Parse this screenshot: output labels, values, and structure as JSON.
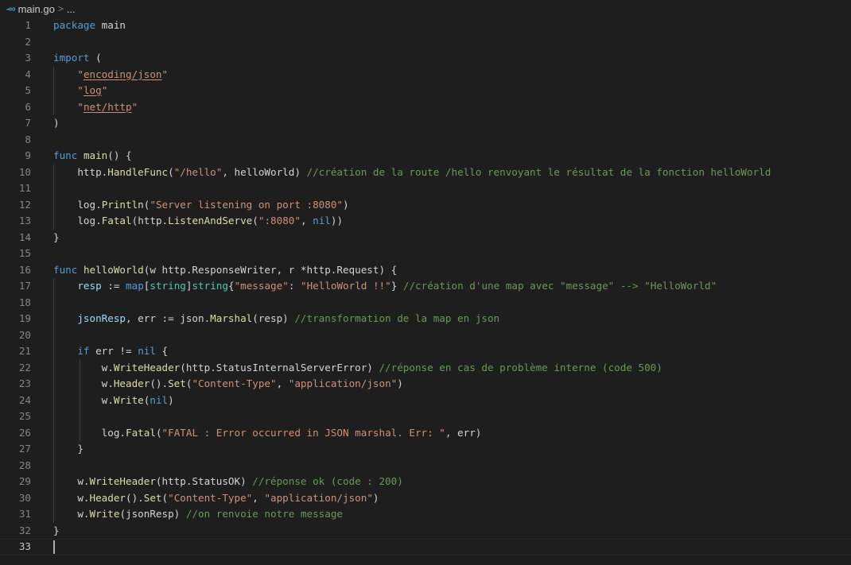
{
  "breadcrumb": {
    "icon": "go-file-icon",
    "icon_glyph": "-∞",
    "file": "main.go",
    "separator": ">",
    "more": "..."
  },
  "editor": {
    "current_line": 33,
    "lines": [
      {
        "n": "1",
        "indent": 0,
        "tokens": [
          {
            "t": "kw",
            "v": "package"
          },
          {
            "t": "pl",
            "v": " main"
          }
        ]
      },
      {
        "n": "2",
        "indent": 0,
        "tokens": []
      },
      {
        "n": "3",
        "indent": 0,
        "tokens": [
          {
            "t": "kw",
            "v": "import"
          },
          {
            "t": "pl",
            "v": " ("
          }
        ]
      },
      {
        "n": "4",
        "indent": 1,
        "tokens": [
          {
            "t": "str",
            "v": "\""
          },
          {
            "t": "imp",
            "v": "encoding/json"
          },
          {
            "t": "str",
            "v": "\""
          }
        ]
      },
      {
        "n": "5",
        "indent": 1,
        "tokens": [
          {
            "t": "str",
            "v": "\""
          },
          {
            "t": "imp",
            "v": "log"
          },
          {
            "t": "str",
            "v": "\""
          }
        ]
      },
      {
        "n": "6",
        "indent": 1,
        "tokens": [
          {
            "t": "str",
            "v": "\""
          },
          {
            "t": "imp",
            "v": "net/http"
          },
          {
            "t": "str",
            "v": "\""
          }
        ]
      },
      {
        "n": "7",
        "indent": 0,
        "tokens": [
          {
            "t": "pl",
            "v": ")"
          }
        ]
      },
      {
        "n": "8",
        "indent": 0,
        "tokens": []
      },
      {
        "n": "9",
        "indent": 0,
        "tokens": [
          {
            "t": "kw",
            "v": "func"
          },
          {
            "t": "pl",
            "v": " "
          },
          {
            "t": "fn",
            "v": "main"
          },
          {
            "t": "pl",
            "v": "() {"
          }
        ]
      },
      {
        "n": "10",
        "indent": 1,
        "tokens": [
          {
            "t": "pl",
            "v": "http."
          },
          {
            "t": "fn",
            "v": "HandleFunc"
          },
          {
            "t": "pl",
            "v": "("
          },
          {
            "t": "str",
            "v": "\"/hello\""
          },
          {
            "t": "pl",
            "v": ", helloWorld) "
          },
          {
            "t": "cmt",
            "v": "//création de la route /hello renvoyant le résultat de la fonction helloWorld"
          }
        ]
      },
      {
        "n": "11",
        "indent": 1,
        "tokens": []
      },
      {
        "n": "12",
        "indent": 1,
        "tokens": [
          {
            "t": "pl",
            "v": "log."
          },
          {
            "t": "fn",
            "v": "Println"
          },
          {
            "t": "pl",
            "v": "("
          },
          {
            "t": "str",
            "v": "\"Server listening on port :8080\""
          },
          {
            "t": "pl",
            "v": ")"
          }
        ]
      },
      {
        "n": "13",
        "indent": 1,
        "tokens": [
          {
            "t": "pl",
            "v": "log."
          },
          {
            "t": "fn",
            "v": "Fatal"
          },
          {
            "t": "pl",
            "v": "(http."
          },
          {
            "t": "fn",
            "v": "ListenAndServe"
          },
          {
            "t": "pl",
            "v": "("
          },
          {
            "t": "str",
            "v": "\":8080\""
          },
          {
            "t": "pl",
            "v": ", "
          },
          {
            "t": "kw",
            "v": "nil"
          },
          {
            "t": "pl",
            "v": "))"
          }
        ]
      },
      {
        "n": "14",
        "indent": 0,
        "tokens": [
          {
            "t": "pl",
            "v": "}"
          }
        ]
      },
      {
        "n": "15",
        "indent": 0,
        "tokens": []
      },
      {
        "n": "16",
        "indent": 0,
        "tokens": [
          {
            "t": "kw",
            "v": "func"
          },
          {
            "t": "pl",
            "v": " "
          },
          {
            "t": "fn",
            "v": "helloWorld"
          },
          {
            "t": "pl",
            "v": "(w http.ResponseWriter, r *http.Request) {"
          }
        ]
      },
      {
        "n": "17",
        "indent": 1,
        "tokens": [
          {
            "t": "var",
            "v": "resp"
          },
          {
            "t": "pl",
            "v": " := "
          },
          {
            "t": "kw",
            "v": "map"
          },
          {
            "t": "pl",
            "v": "["
          },
          {
            "t": "typ",
            "v": "string"
          },
          {
            "t": "pl",
            "v": "]"
          },
          {
            "t": "typ",
            "v": "string"
          },
          {
            "t": "pl",
            "v": "{"
          },
          {
            "t": "str",
            "v": "\"message\""
          },
          {
            "t": "pl",
            "v": ": "
          },
          {
            "t": "str",
            "v": "\"HelloWorld !!\""
          },
          {
            "t": "pl",
            "v": "} "
          },
          {
            "t": "cmt",
            "v": "//création d'une map avec \"message\" --> \"HelloWorld\""
          }
        ]
      },
      {
        "n": "18",
        "indent": 1,
        "tokens": []
      },
      {
        "n": "19",
        "indent": 1,
        "tokens": [
          {
            "t": "var",
            "v": "jsonResp"
          },
          {
            "t": "pl",
            "v": ", err := json."
          },
          {
            "t": "fn",
            "v": "Marshal"
          },
          {
            "t": "pl",
            "v": "(resp) "
          },
          {
            "t": "cmt",
            "v": "//transformation de la map en json"
          }
        ]
      },
      {
        "n": "20",
        "indent": 1,
        "tokens": []
      },
      {
        "n": "21",
        "indent": 1,
        "tokens": [
          {
            "t": "kw",
            "v": "if"
          },
          {
            "t": "pl",
            "v": " err != "
          },
          {
            "t": "kw",
            "v": "nil"
          },
          {
            "t": "pl",
            "v": " {"
          }
        ]
      },
      {
        "n": "22",
        "indent": 2,
        "tokens": [
          {
            "t": "pl",
            "v": "w."
          },
          {
            "t": "fn",
            "v": "WriteHeader"
          },
          {
            "t": "pl",
            "v": "(http.StatusInternalServerError) "
          },
          {
            "t": "cmt",
            "v": "//réponse en cas de problème interne (code 500)"
          }
        ]
      },
      {
        "n": "23",
        "indent": 2,
        "tokens": [
          {
            "t": "pl",
            "v": "w."
          },
          {
            "t": "fn",
            "v": "Header"
          },
          {
            "t": "pl",
            "v": "()."
          },
          {
            "t": "fn",
            "v": "Set"
          },
          {
            "t": "pl",
            "v": "("
          },
          {
            "t": "str",
            "v": "\"Content-Type\""
          },
          {
            "t": "pl",
            "v": ", "
          },
          {
            "t": "str",
            "v": "\"application/json\""
          },
          {
            "t": "pl",
            "v": ")"
          }
        ]
      },
      {
        "n": "24",
        "indent": 2,
        "tokens": [
          {
            "t": "pl",
            "v": "w."
          },
          {
            "t": "fn",
            "v": "Write"
          },
          {
            "t": "pl",
            "v": "("
          },
          {
            "t": "kw",
            "v": "nil"
          },
          {
            "t": "pl",
            "v": ")"
          }
        ]
      },
      {
        "n": "25",
        "indent": 2,
        "tokens": []
      },
      {
        "n": "26",
        "indent": 2,
        "tokens": [
          {
            "t": "pl",
            "v": "log."
          },
          {
            "t": "fn",
            "v": "Fatal"
          },
          {
            "t": "pl",
            "v": "("
          },
          {
            "t": "str",
            "v": "\"FATAL : Error occurred in JSON marshal. Err: \""
          },
          {
            "t": "pl",
            "v": ", err)"
          }
        ]
      },
      {
        "n": "27",
        "indent": 1,
        "tokens": [
          {
            "t": "pl",
            "v": "}"
          }
        ]
      },
      {
        "n": "28",
        "indent": 1,
        "tokens": []
      },
      {
        "n": "29",
        "indent": 1,
        "tokens": [
          {
            "t": "pl",
            "v": "w."
          },
          {
            "t": "fn",
            "v": "WriteHeader"
          },
          {
            "t": "pl",
            "v": "(http.StatusOK) "
          },
          {
            "t": "cmt",
            "v": "//réponse ok (code : 200)"
          }
        ]
      },
      {
        "n": "30",
        "indent": 1,
        "tokens": [
          {
            "t": "pl",
            "v": "w."
          },
          {
            "t": "fn",
            "v": "Header"
          },
          {
            "t": "pl",
            "v": "()."
          },
          {
            "t": "fn",
            "v": "Set"
          },
          {
            "t": "pl",
            "v": "("
          },
          {
            "t": "str",
            "v": "\"Content-Type\""
          },
          {
            "t": "pl",
            "v": ", "
          },
          {
            "t": "str",
            "v": "\"application/json\""
          },
          {
            "t": "pl",
            "v": ")"
          }
        ]
      },
      {
        "n": "31",
        "indent": 1,
        "tokens": [
          {
            "t": "pl",
            "v": "w."
          },
          {
            "t": "fn",
            "v": "Write"
          },
          {
            "t": "pl",
            "v": "(jsonResp) "
          },
          {
            "t": "cmt",
            "v": "//on renvoie notre message"
          }
        ]
      },
      {
        "n": "32",
        "indent": 0,
        "tokens": [
          {
            "t": "pl",
            "v": "}"
          }
        ]
      },
      {
        "n": "33",
        "indent": 0,
        "tokens": []
      }
    ]
  }
}
